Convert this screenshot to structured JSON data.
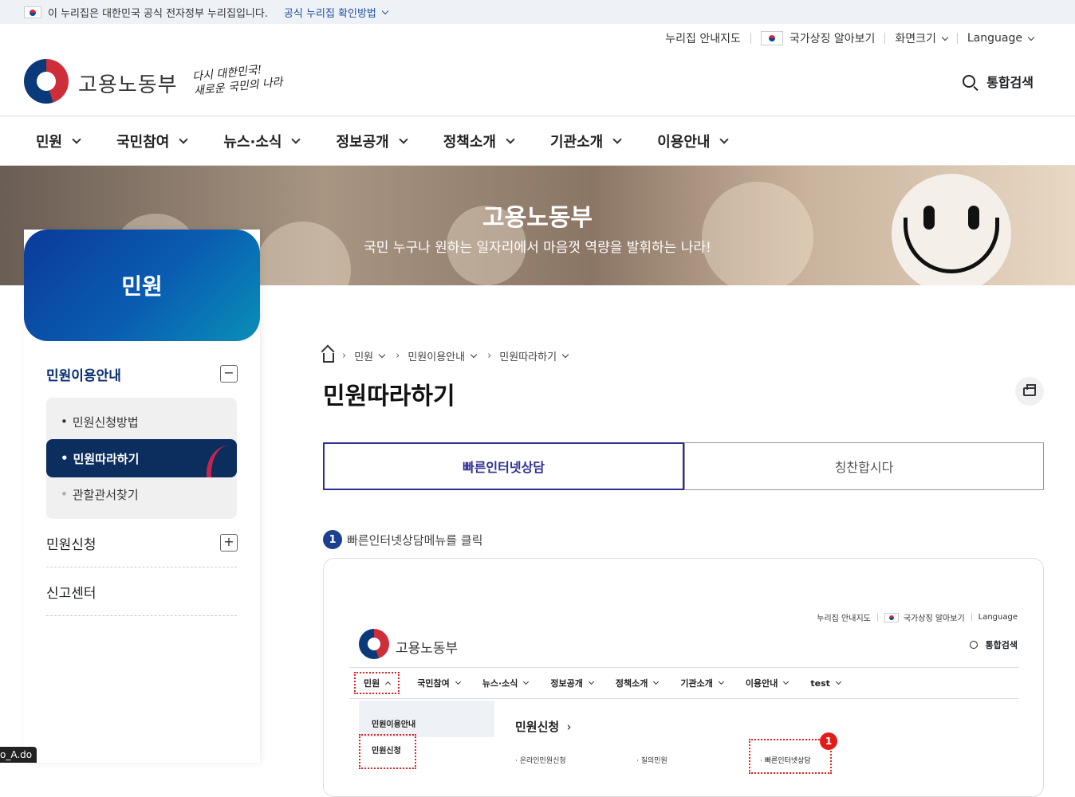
{
  "gov_banner": {
    "text": "이 누리집은 대한민국 공식 전자정부 누리집입니다.",
    "link": "공식 누리집 확인방법"
  },
  "utility": {
    "sitemap": "누리집 안내지도",
    "symbol": "국가상징 알아보기",
    "zoom": "화면크기",
    "language": "Language"
  },
  "header": {
    "logo_text": "고용노동부",
    "slogan_line1": "다시 대한민국!",
    "slogan_line2": "새로운 국민의 나라",
    "search_label": "통합검색"
  },
  "gnb": [
    "민원",
    "국민참여",
    "뉴스·소식",
    "정보공개",
    "정책소개",
    "기관소개",
    "이용안내"
  ],
  "hero": {
    "title": "고용노동부",
    "subtitle": "국민 누구나 원하는 일자리에서 마음껏 역량을 발휘하는 나라!"
  },
  "sidebar": {
    "title": "민원",
    "section1": "민원이용안내",
    "section1_toggle": "−",
    "sub_items": [
      "민원신청방법",
      "민원따라하기",
      "관할관서찾기"
    ],
    "section2": "민원신청",
    "section2_toggle": "+",
    "section3": "신고센터"
  },
  "breadcrumb": [
    "민원",
    "민원이용안내",
    "민원따라하기"
  ],
  "page_title": "민원따라하기",
  "tabs": [
    "빠른인터넷상담",
    "칭찬합시다"
  ],
  "step": {
    "number": "1",
    "text": "빠른인터넷상담메뉴를 클릭"
  },
  "screenshot": {
    "util_sitemap": "누리집 안내지도",
    "util_symbol": "국가상징 알아보기",
    "util_language": "Language",
    "logo_text": "고용노동부",
    "search_label": "통합검색",
    "gnb": [
      "민원",
      "국민참여",
      "뉴스·소식",
      "정보공개",
      "정책소개",
      "기관소개",
      "이용안내",
      "test"
    ],
    "left_active": "민원이용안내",
    "left_highlight": "민원신청",
    "panel_title": "민원신청",
    "panel_arrow": "›",
    "rows": [
      "· 온라인민원신청",
      "· 질의민원"
    ],
    "target_item": "· 빠른인터넷상담",
    "badge": "1"
  },
  "status_bar": "o_A.do"
}
